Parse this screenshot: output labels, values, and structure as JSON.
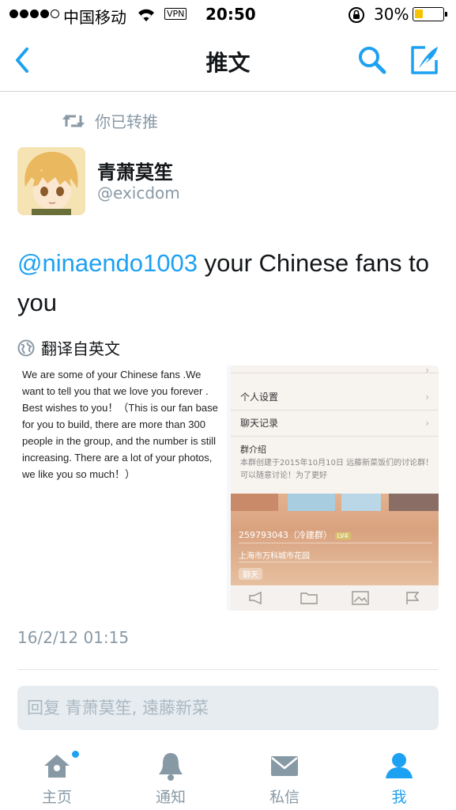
{
  "status_bar": {
    "carrier": "中国移动",
    "vpn": "VPN",
    "time": "20:50",
    "battery": "30%",
    "battery_level": 0.3,
    "signal_bars": 4
  },
  "nav": {
    "title": "推文"
  },
  "retweet": {
    "label": "你已转推"
  },
  "author": {
    "name": "青萧莫笙",
    "handle": "@exicdom"
  },
  "tweet": {
    "mention": "@ninaendo1003",
    "text": " your Chinese fans to you",
    "translate_label": "翻译自英文",
    "timestamp": "16/2/12 01:15"
  },
  "media": {
    "left_text": "We are some of your Chinese fans .We want to tell you that we love you forever . Best wishes to  you！（This is our fan base for you to build, there are more than 300 people in the group, and the number is still increasing. There are a lot of your photos, we like you so much！）",
    "right": {
      "rows": [
        "个人设置",
        "聊天记录"
      ],
      "intro_title": "群介绍",
      "intro_text": "本群创建于2015年10月10日 远藤新菜饭们的讨论群！可以随意讨论！为了更好",
      "group_id": "259793043（冷建群）",
      "level_badge": "LV4",
      "address": "上海市万科城市花园",
      "chat_label": "聊天"
    }
  },
  "reply": {
    "placeholder": "回复 青萧莫笙, 遠藤新菜"
  },
  "tabs": [
    {
      "label": "主页",
      "icon": "home-icon",
      "active": false
    },
    {
      "label": "通知",
      "icon": "bell-icon",
      "active": false
    },
    {
      "label": "私信",
      "icon": "envelope-icon",
      "active": false
    },
    {
      "label": "我",
      "icon": "person-icon",
      "active": true
    }
  ],
  "colors": {
    "accent": "#1da1f2",
    "muted": "#8899a6",
    "text": "#14171a"
  }
}
